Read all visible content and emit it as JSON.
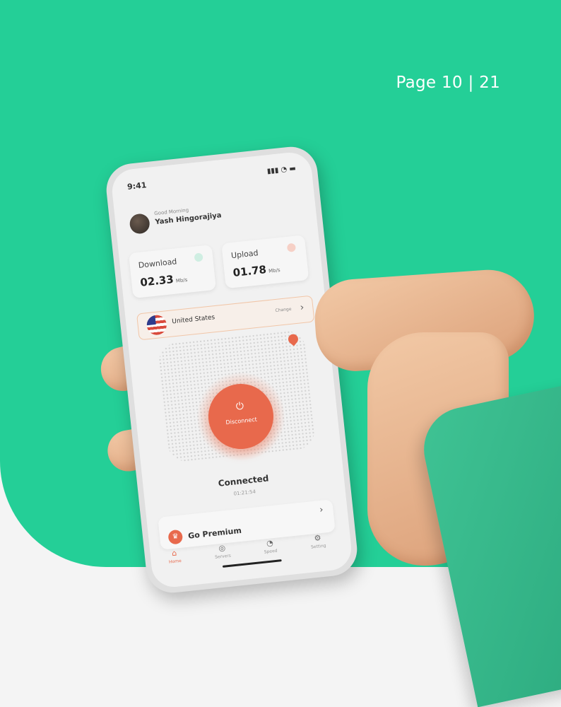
{
  "page": {
    "indicator": "Page 10 | 21",
    "accent_color": "#24cf97",
    "brand_color": "#e8694c"
  },
  "app": {
    "status": {
      "time": "9:41",
      "icons": "all-signal wifi battery"
    },
    "greeting": "Good Morning",
    "user_name": "Yash Hingorajiya",
    "download": {
      "label": "Download",
      "value": "02.33",
      "unit": "Mb/s"
    },
    "upload": {
      "label": "Upload",
      "value": "01.78",
      "unit": "Mb/s"
    },
    "server": {
      "country": "United States",
      "change_label": "Change"
    },
    "power": {
      "label": "Disconnect",
      "icon": "power-icon"
    },
    "connection": {
      "status": "Connected",
      "timer": "01:21:54"
    },
    "premium": {
      "label": "Go Premium",
      "icon": "crown-icon"
    },
    "tabs": [
      {
        "label": "Home",
        "icon": "home-icon"
      },
      {
        "label": "Servers",
        "icon": "globe-icon"
      },
      {
        "label": "Speed",
        "icon": "gauge-icon"
      },
      {
        "label": "Setting",
        "icon": "gear-icon"
      }
    ]
  }
}
